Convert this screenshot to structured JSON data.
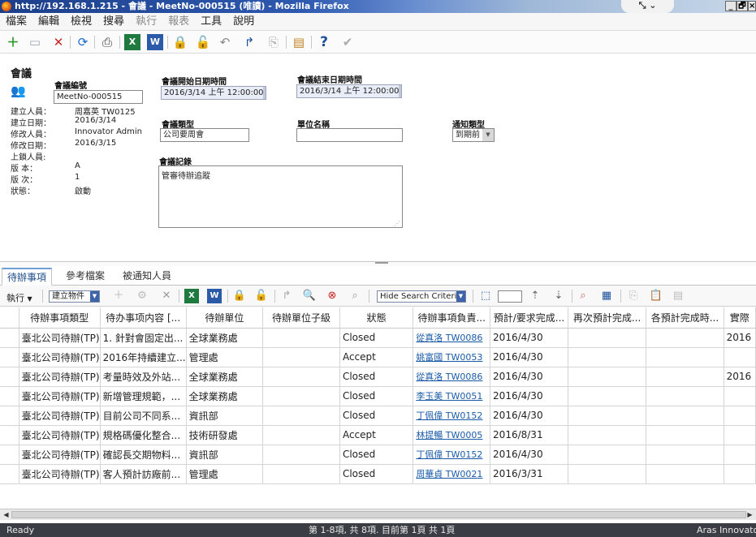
{
  "window": {
    "title": "http://192.168.1.215 - 會議 - MeetNo-000515 (唯讀) - Mozilla Firefox",
    "minimize": "_",
    "restore": "🗗",
    "close": "×"
  },
  "menu": [
    "檔案",
    "編輯",
    "檢視",
    "搜尋",
    "執行",
    "報表",
    "工具",
    "說明"
  ],
  "menu_disabled": [
    4,
    5
  ],
  "form": {
    "title": "會議",
    "meeting_no_label": "會議編號",
    "meeting_no_value": "MeetNo-000515",
    "meta": [
      {
        "label": "建立人員：",
        "value": "周嘉英 TW0125"
      },
      {
        "label": "建立日期：",
        "value": "2016/3/14"
      },
      {
        "label": "修改人員：",
        "value": "Innovator Admin"
      },
      {
        "label": "修改日期：",
        "value": "2016/3/15"
      },
      {
        "label": "上鎖人員:",
        "value": ""
      },
      {
        "label": "版 本：",
        "value": "A"
      },
      {
        "label": "版 次：",
        "value": "1"
      },
      {
        "label": "狀態：",
        "value": "啟動"
      }
    ],
    "start_label": "會議開始日期時間",
    "start_value": "2016/3/14 上午 12:00:00",
    "end_label": "會議結束日期時間",
    "end_value": "2016/3/14 上午 12:00:00",
    "type_label": "會議類型",
    "type_value": "公司要周會",
    "unit_label": "單位名稱",
    "unit_value": "",
    "notify_label": "通知類型",
    "notify_value": "到期前",
    "record_label": "會議記錄",
    "record_value": "管審待辦追蹤"
  },
  "tabs": [
    "待辦事項",
    "參考檔案",
    "被通知人員"
  ],
  "grid_toolbar": {
    "execute_label": "執行",
    "create_label": "建立物件",
    "search_mode": "Hide Search Criteria"
  },
  "grid": {
    "columns": [
      "待辦事項類型",
      "待办事项内容 [...",
      "待辦單位",
      "待辦單位子級",
      "狀態",
      "待辦事項負責...",
      "預計/要求完成...",
      "再次預計完成...",
      "各預計完成時...",
      "實際"
    ],
    "rows": [
      [
        "臺北公司待辦(TP)",
        "1. 針對會固定出...",
        "全球業務處",
        "",
        "Closed",
        "從真洛 TW0086",
        "2016/4/30",
        "",
        "",
        "2016"
      ],
      [
        "臺北公司待辦(TP)",
        "2016年持續建立...",
        "管理處",
        "",
        "Accept",
        "姚富國 TW0053",
        "2016/4/30",
        "",
        "",
        ""
      ],
      [
        "臺北公司待辦(TP)",
        "考量時效及外站...",
        "全球業務處",
        "",
        "Closed",
        "從真洛 TW0086",
        "2016/4/30",
        "",
        "",
        "2016"
      ],
      [
        "臺北公司待辦(TP)",
        "新增管理規範，...",
        "全球業務處",
        "",
        "Closed",
        "李玉美 TW0051",
        "2016/4/30",
        "",
        "",
        ""
      ],
      [
        "臺北公司待辦(TP)",
        "目前公司不同系...",
        "資訊部",
        "",
        "Closed",
        "丁佩偉 TW0152",
        "2016/4/30",
        "",
        "",
        ""
      ],
      [
        "臺北公司待辦(TP)",
        "規格碼優化整合...",
        "技術研發處",
        "",
        "Accept",
        "林提暢 TW0005",
        "2016/8/31",
        "",
        "",
        ""
      ],
      [
        "臺北公司待辦(TP)",
        "確認長交期物料...",
        "資訊部",
        "",
        "Closed",
        "丁佩偉 TW0152",
        "2016/4/30",
        "",
        "",
        ""
      ],
      [
        "臺北公司待辦(TP)",
        "客人預計訪廠前...",
        "管理處",
        "",
        "Closed",
        "周華貞 TW0021",
        "2016/3/31",
        "",
        "",
        ""
      ]
    ]
  },
  "status": {
    "left": "Ready",
    "center": "第 1-8項, 共 8項. 目前第 1頁 共 1頁",
    "right": "Aras Innovator"
  },
  "colors": {
    "tab_active": "#1f4e8c",
    "link": "#1a5ba8",
    "statusbar": "#3a3e44"
  }
}
